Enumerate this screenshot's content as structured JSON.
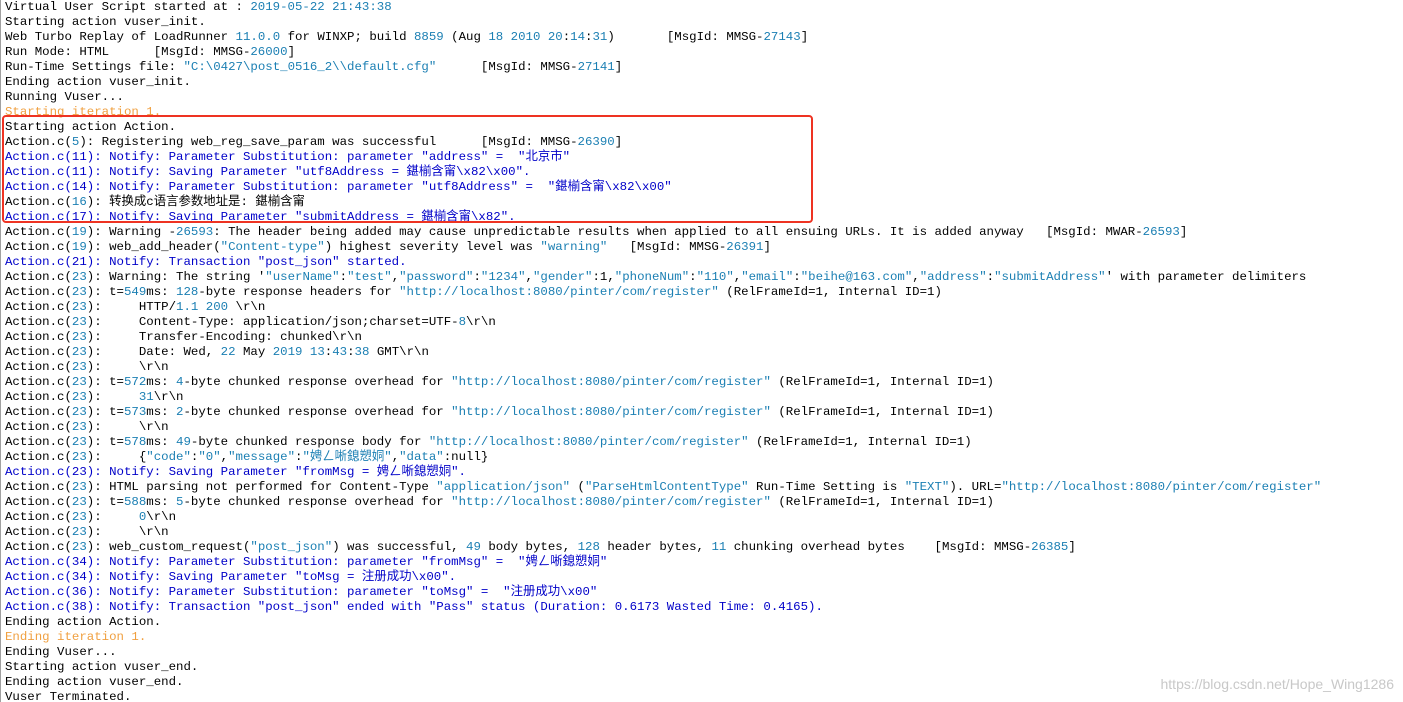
{
  "colors": {
    "normal": "#000000",
    "notify_blue": "#0000c8",
    "iteration_orange": "#f0a040",
    "string_literal": "#1b7fb3",
    "highlight_border": "#ee3322",
    "watermark": "#c8c8c8"
  },
  "watermark": "https://blog.csdn.net/Hope_Wing1286",
  "lines": [
    {
      "kind": "normal",
      "segments": [
        {
          "t": "Virtual User Script started at : "
        },
        {
          "t": "2019-05-22 21:43:38",
          "c": "s"
        }
      ]
    },
    {
      "kind": "normal",
      "segments": [
        {
          "t": "Starting action vuser_init."
        }
      ]
    },
    {
      "kind": "normal",
      "segments": [
        {
          "t": "Web Turbo Replay of LoadRunner "
        },
        {
          "t": "11.0.0",
          "c": "s"
        },
        {
          "t": " for WINXP; build "
        },
        {
          "t": "8859",
          "c": "s"
        },
        {
          "t": " (Aug "
        },
        {
          "t": "18 2010 20",
          "c": "s"
        },
        {
          "t": ":"
        },
        {
          "t": "14",
          "c": "s"
        },
        {
          "t": ":"
        },
        {
          "t": "31",
          "c": "s"
        },
        {
          "t": ")       [MsgId: MMSG-"
        },
        {
          "t": "27143",
          "c": "s"
        },
        {
          "t": "]"
        }
      ]
    },
    {
      "kind": "normal",
      "segments": [
        {
          "t": "Run Mode: HTML      [MsgId: MMSG-"
        },
        {
          "t": "26000",
          "c": "s"
        },
        {
          "t": "]"
        }
      ]
    },
    {
      "kind": "normal",
      "segments": [
        {
          "t": "Run-Time Settings file: "
        },
        {
          "t": "\"C:\\0427\\post_0516_2\\\\default.cfg\"",
          "c": "s"
        },
        {
          "t": "      [MsgId: MMSG-"
        },
        {
          "t": "27141",
          "c": "s"
        },
        {
          "t": "]"
        }
      ]
    },
    {
      "kind": "normal",
      "segments": [
        {
          "t": "Ending action vuser_init."
        }
      ]
    },
    {
      "kind": "normal",
      "segments": [
        {
          "t": "Running Vuser..."
        }
      ]
    },
    {
      "kind": "orange",
      "segments": [
        {
          "t": "Starting iteration 1."
        }
      ]
    },
    {
      "kind": "normal",
      "segments": [
        {
          "t": "Starting action Action."
        }
      ]
    },
    {
      "kind": "normal",
      "segments": [
        {
          "t": "Action.c("
        },
        {
          "t": "5",
          "c": "s"
        },
        {
          "t": "): Registering web_reg_save_param was successful      [MsgId: MMSG-"
        },
        {
          "t": "26390",
          "c": "s"
        },
        {
          "t": "]"
        }
      ]
    },
    {
      "kind": "blue",
      "segments": [
        {
          "t": "Action.c(11): Notify: Parameter Substitution: parameter \"address\" =  \"北京市\""
        }
      ]
    },
    {
      "kind": "blue",
      "segments": [
        {
          "t": "Action.c(11): Notify: Saving Parameter \"utf8Address = 鍖椾含甯\\x82\\x00\"."
        }
      ]
    },
    {
      "kind": "blue",
      "segments": [
        {
          "t": "Action.c(14): Notify: Parameter Substitution: parameter \"utf8Address\" =  \"鍖椾含甯\\x82\\x00\""
        }
      ]
    },
    {
      "kind": "normal",
      "segments": [
        {
          "t": "Action.c("
        },
        {
          "t": "16",
          "c": "s"
        },
        {
          "t": "): 转换成c语言参数地址是: 鍖椾含甯"
        }
      ]
    },
    {
      "kind": "blue",
      "segments": [
        {
          "t": "Action.c(17): Notify: Saving Parameter \"submitAddress = 鍖椾含甯\\x82\"."
        }
      ]
    },
    {
      "kind": "normal",
      "segments": [
        {
          "t": "Action.c("
        },
        {
          "t": "19",
          "c": "s"
        },
        {
          "t": "): Warning -"
        },
        {
          "t": "26593",
          "c": "s"
        },
        {
          "t": ": The header being added may cause unpredictable results when applied to all ensuing URLs. It is added anyway   [MsgId: MWAR-"
        },
        {
          "t": "26593",
          "c": "s"
        },
        {
          "t": "]"
        }
      ]
    },
    {
      "kind": "normal",
      "segments": [
        {
          "t": "Action.c("
        },
        {
          "t": "19",
          "c": "s"
        },
        {
          "t": "): web_add_header("
        },
        {
          "t": "\"Content-type\"",
          "c": "s"
        },
        {
          "t": ") highest severity level was "
        },
        {
          "t": "\"warning\"",
          "c": "s"
        },
        {
          "t": "   [MsgId: MMSG-"
        },
        {
          "t": "26391",
          "c": "s"
        },
        {
          "t": "]"
        }
      ]
    },
    {
      "kind": "blue",
      "segments": [
        {
          "t": "Action.c(21): Notify: Transaction \"post_json\" started."
        }
      ]
    },
    {
      "kind": "normal",
      "segments": [
        {
          "t": "Action.c("
        },
        {
          "t": "23",
          "c": "s"
        },
        {
          "t": "): Warning: The string '"
        },
        {
          "t": "\"userName\"",
          "c": "s"
        },
        {
          "t": ":"
        },
        {
          "t": "\"test\"",
          "c": "s"
        },
        {
          "t": ","
        },
        {
          "t": "\"password\"",
          "c": "s"
        },
        {
          "t": ":"
        },
        {
          "t": "\"1234\"",
          "c": "s"
        },
        {
          "t": ","
        },
        {
          "t": "\"gender\"",
          "c": "s"
        },
        {
          "t": ":1,"
        },
        {
          "t": "\"phoneNum\"",
          "c": "s"
        },
        {
          "t": ":"
        },
        {
          "t": "\"110\"",
          "c": "s"
        },
        {
          "t": ","
        },
        {
          "t": "\"email\"",
          "c": "s"
        },
        {
          "t": ":"
        },
        {
          "t": "\"beihe@163.com\"",
          "c": "s"
        },
        {
          "t": ","
        },
        {
          "t": "\"address\"",
          "c": "s"
        },
        {
          "t": ":"
        },
        {
          "t": "\"submitAddress\"",
          "c": "s"
        },
        {
          "t": "' with parameter delimiters"
        }
      ]
    },
    {
      "kind": "normal",
      "segments": [
        {
          "t": "Action.c("
        },
        {
          "t": "23",
          "c": "s"
        },
        {
          "t": "): t="
        },
        {
          "t": "549",
          "c": "s"
        },
        {
          "t": "ms: "
        },
        {
          "t": "128",
          "c": "s"
        },
        {
          "t": "-byte response headers for "
        },
        {
          "t": "\"http://localhost:8080/pinter/com/register\"",
          "c": "s"
        },
        {
          "t": " (RelFrameId=1, Internal ID=1)"
        }
      ]
    },
    {
      "kind": "normal",
      "segments": [
        {
          "t": "Action.c("
        },
        {
          "t": "23",
          "c": "s"
        },
        {
          "t": "):     HTTP/"
        },
        {
          "t": "1.1 200",
          "c": "s"
        },
        {
          "t": " \\r\\n"
        }
      ]
    },
    {
      "kind": "normal",
      "segments": [
        {
          "t": "Action.c("
        },
        {
          "t": "23",
          "c": "s"
        },
        {
          "t": "):     Content-Type: application/json;charset=UTF-"
        },
        {
          "t": "8",
          "c": "s"
        },
        {
          "t": "\\r\\n"
        }
      ]
    },
    {
      "kind": "normal",
      "segments": [
        {
          "t": "Action.c("
        },
        {
          "t": "23",
          "c": "s"
        },
        {
          "t": "):     Transfer-Encoding: chunked\\r\\n"
        }
      ]
    },
    {
      "kind": "normal",
      "segments": [
        {
          "t": "Action.c("
        },
        {
          "t": "23",
          "c": "s"
        },
        {
          "t": "):     Date: Wed, "
        },
        {
          "t": "22",
          "c": "s"
        },
        {
          "t": " May "
        },
        {
          "t": "2019 13",
          "c": "s"
        },
        {
          "t": ":"
        },
        {
          "t": "43",
          "c": "s"
        },
        {
          "t": ":"
        },
        {
          "t": "38",
          "c": "s"
        },
        {
          "t": " GMT\\r\\n"
        }
      ]
    },
    {
      "kind": "normal",
      "segments": [
        {
          "t": "Action.c("
        },
        {
          "t": "23",
          "c": "s"
        },
        {
          "t": "):     \\r\\n"
        }
      ]
    },
    {
      "kind": "normal",
      "segments": [
        {
          "t": "Action.c("
        },
        {
          "t": "23",
          "c": "s"
        },
        {
          "t": "): t="
        },
        {
          "t": "572",
          "c": "s"
        },
        {
          "t": "ms: "
        },
        {
          "t": "4",
          "c": "s"
        },
        {
          "t": "-byte chunked response overhead for "
        },
        {
          "t": "\"http://localhost:8080/pinter/com/register\"",
          "c": "s"
        },
        {
          "t": " (RelFrameId=1, Internal ID=1)"
        }
      ]
    },
    {
      "kind": "normal",
      "segments": [
        {
          "t": "Action.c("
        },
        {
          "t": "23",
          "c": "s"
        },
        {
          "t": "):     "
        },
        {
          "t": "31",
          "c": "s"
        },
        {
          "t": "\\r\\n"
        }
      ]
    },
    {
      "kind": "normal",
      "segments": [
        {
          "t": "Action.c("
        },
        {
          "t": "23",
          "c": "s"
        },
        {
          "t": "): t="
        },
        {
          "t": "573",
          "c": "s"
        },
        {
          "t": "ms: "
        },
        {
          "t": "2",
          "c": "s"
        },
        {
          "t": "-byte chunked response overhead for "
        },
        {
          "t": "\"http://localhost:8080/pinter/com/register\"",
          "c": "s"
        },
        {
          "t": " (RelFrameId=1, Internal ID=1)"
        }
      ]
    },
    {
      "kind": "normal",
      "segments": [
        {
          "t": "Action.c("
        },
        {
          "t": "23",
          "c": "s"
        },
        {
          "t": "):     \\r\\n"
        }
      ]
    },
    {
      "kind": "normal",
      "segments": [
        {
          "t": "Action.c("
        },
        {
          "t": "23",
          "c": "s"
        },
        {
          "t": "): t="
        },
        {
          "t": "578",
          "c": "s"
        },
        {
          "t": "ms: "
        },
        {
          "t": "49",
          "c": "s"
        },
        {
          "t": "-byte chunked response body for "
        },
        {
          "t": "\"http://localhost:8080/pinter/com/register\"",
          "c": "s"
        },
        {
          "t": " (RelFrameId=1, Internal ID=1)"
        }
      ]
    },
    {
      "kind": "normal",
      "segments": [
        {
          "t": "Action.c("
        },
        {
          "t": "23",
          "c": "s"
        },
        {
          "t": "):     {"
        },
        {
          "t": "\"code\"",
          "c": "s"
        },
        {
          "t": ":"
        },
        {
          "t": "\"0\"",
          "c": "s"
        },
        {
          "t": ","
        },
        {
          "t": "\"message\"",
          "c": "s"
        },
        {
          "t": ":"
        },
        {
          "t": "\"娉ㄥ唽鎴愬姛\"",
          "c": "s"
        },
        {
          "t": ","
        },
        {
          "t": "\"data\"",
          "c": "s"
        },
        {
          "t": ":null}"
        }
      ]
    },
    {
      "kind": "blue",
      "segments": [
        {
          "t": "Action.c(23): Notify: Saving Parameter \"fromMsg = 娉ㄥ唽鎴愬姛\"."
        }
      ]
    },
    {
      "kind": "normal",
      "segments": [
        {
          "t": "Action.c("
        },
        {
          "t": "23",
          "c": "s"
        },
        {
          "t": "): HTML parsing not performed for Content-Type "
        },
        {
          "t": "\"application/json\"",
          "c": "s"
        },
        {
          "t": " ("
        },
        {
          "t": "\"ParseHtmlContentType\"",
          "c": "s"
        },
        {
          "t": " Run-Time Setting is "
        },
        {
          "t": "\"TEXT\"",
          "c": "s"
        },
        {
          "t": "). URL="
        },
        {
          "t": "\"http://localhost:8080/pinter/com/register\"",
          "c": "s"
        }
      ]
    },
    {
      "kind": "normal",
      "segments": [
        {
          "t": "Action.c("
        },
        {
          "t": "23",
          "c": "s"
        },
        {
          "t": "): t="
        },
        {
          "t": "588",
          "c": "s"
        },
        {
          "t": "ms: "
        },
        {
          "t": "5",
          "c": "s"
        },
        {
          "t": "-byte chunked response overhead for "
        },
        {
          "t": "\"http://localhost:8080/pinter/com/register\"",
          "c": "s"
        },
        {
          "t": " (RelFrameId=1, Internal ID=1)"
        }
      ]
    },
    {
      "kind": "normal",
      "segments": [
        {
          "t": "Action.c("
        },
        {
          "t": "23",
          "c": "s"
        },
        {
          "t": "):     "
        },
        {
          "t": "0",
          "c": "s"
        },
        {
          "t": "\\r\\n"
        }
      ]
    },
    {
      "kind": "normal",
      "segments": [
        {
          "t": "Action.c("
        },
        {
          "t": "23",
          "c": "s"
        },
        {
          "t": "):     \\r\\n"
        }
      ]
    },
    {
      "kind": "normal",
      "segments": [
        {
          "t": "Action.c("
        },
        {
          "t": "23",
          "c": "s"
        },
        {
          "t": "): web_custom_request("
        },
        {
          "t": "\"post_json\"",
          "c": "s"
        },
        {
          "t": ") was successful, "
        },
        {
          "t": "49",
          "c": "s"
        },
        {
          "t": " body bytes, "
        },
        {
          "t": "128",
          "c": "s"
        },
        {
          "t": " header bytes, "
        },
        {
          "t": "11",
          "c": "s"
        },
        {
          "t": " chunking overhead bytes    [MsgId: MMSG-"
        },
        {
          "t": "26385",
          "c": "s"
        },
        {
          "t": "]"
        }
      ]
    },
    {
      "kind": "blue",
      "segments": [
        {
          "t": "Action.c(34): Notify: Parameter Substitution: parameter \"fromMsg\" =  \"娉ㄥ唽鎴愬姛\""
        }
      ]
    },
    {
      "kind": "blue",
      "segments": [
        {
          "t": "Action.c(34): Notify: Saving Parameter \"toMsg = 注册成功\\x00\"."
        }
      ]
    },
    {
      "kind": "blue",
      "segments": [
        {
          "t": "Action.c(36): Notify: Parameter Substitution: parameter \"toMsg\" =  \"注册成功\\x00\""
        }
      ]
    },
    {
      "kind": "blue",
      "segments": [
        {
          "t": "Action.c(38): Notify: Transaction \"post_json\" ended with \"Pass\" status (Duration: 0.6173 Wasted Time: 0.4165)."
        }
      ]
    },
    {
      "kind": "normal",
      "segments": [
        {
          "t": "Ending action Action."
        }
      ]
    },
    {
      "kind": "orange",
      "segments": [
        {
          "t": "Ending iteration 1."
        }
      ]
    },
    {
      "kind": "normal",
      "segments": [
        {
          "t": "Ending Vuser..."
        }
      ]
    },
    {
      "kind": "normal",
      "segments": [
        {
          "t": "Starting action vuser_end."
        }
      ]
    },
    {
      "kind": "normal",
      "segments": [
        {
          "t": "Ending action vuser_end."
        }
      ]
    },
    {
      "kind": "normal",
      "segments": [
        {
          "t": "Vuser Terminated."
        }
      ]
    }
  ]
}
